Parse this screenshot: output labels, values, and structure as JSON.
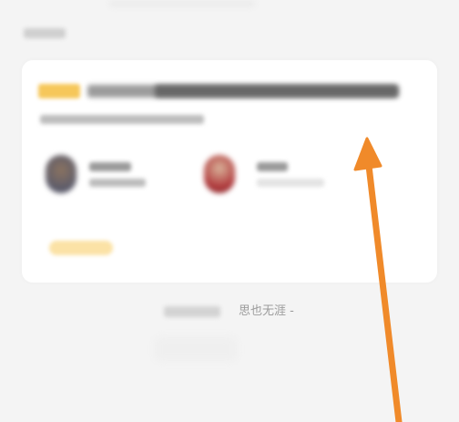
{
  "colors": {
    "background": "#f4f4f4",
    "card": "#ffffff",
    "tag": "#f6c75a",
    "pill": "#fbe2a6",
    "arrow": "#f08a2a",
    "footer_text": "#9c9c9c"
  },
  "section": {
    "label": ""
  },
  "card": {
    "tag": "",
    "title": "",
    "subtitle": "",
    "people": [
      {
        "name": "",
        "subtitle": ""
      },
      {
        "name": "",
        "subtitle": ""
      }
    ],
    "pill": ""
  },
  "footer": {
    "prefix": "",
    "text": "思也无涯 -"
  },
  "icons": {
    "annotation": "arrow-up-icon"
  }
}
